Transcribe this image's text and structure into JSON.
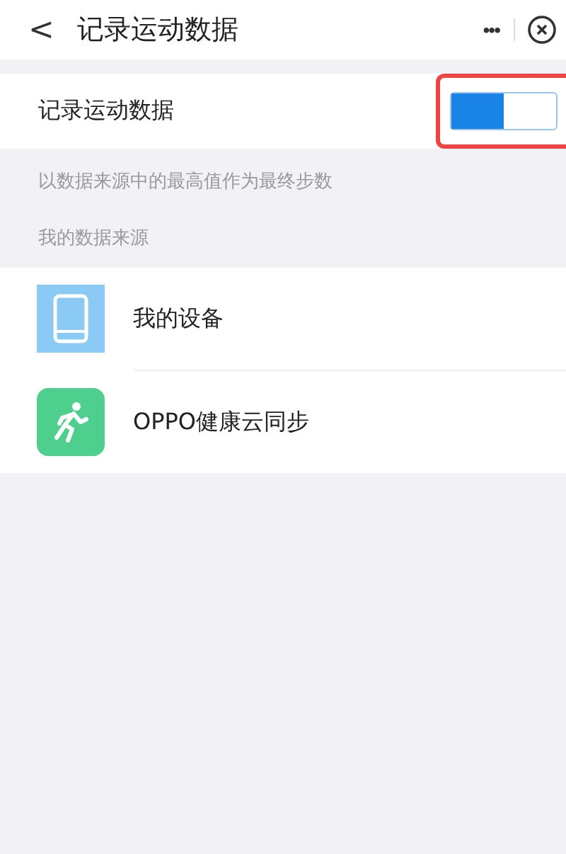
{
  "header": {
    "back": "<",
    "title": "记录运动数据",
    "more": "•••"
  },
  "setting": {
    "label": "记录运动数据",
    "on": true,
    "highlighted": true
  },
  "hint": "以数据来源中的最高值作为最终步数",
  "sources_title": "我的数据来源",
  "sources": [
    {
      "kind": "device",
      "name": "我的设备"
    },
    {
      "kind": "run",
      "name": "OPPO健康云同步"
    }
  ]
}
